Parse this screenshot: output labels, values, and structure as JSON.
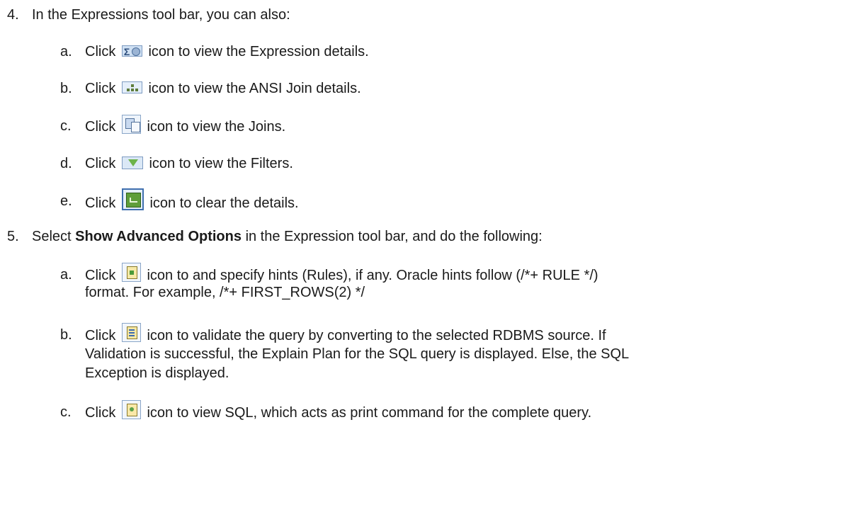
{
  "steps": [
    {
      "number": "4.",
      "text": "In the Expressions tool bar, you can also:",
      "items": [
        {
          "letter": "a.",
          "before": "Click",
          "icon": "expression-details-icon",
          "after": "icon to view the Expression details."
        },
        {
          "letter": "b.",
          "before": "Click",
          "icon": "ansi-join-icon",
          "after": "icon to view the ANSI Join details."
        },
        {
          "letter": "c.",
          "before": "Click",
          "icon": "joins-icon",
          "after": "icon to view the Joins."
        },
        {
          "letter": "d.",
          "before": "Click",
          "icon": "filter-icon",
          "after": "icon to view the Filters."
        },
        {
          "letter": "e.",
          "before": "Click",
          "icon": "clear-details-icon",
          "after": "icon to clear the details."
        }
      ]
    },
    {
      "number": "5.",
      "text_before": "Select",
      "text_bold": "Show Advanced Options",
      "text_after": "in the Expression tool bar, and do the following:",
      "items": [
        {
          "letter": "a.",
          "before": "Click",
          "icon": "hints-icon",
          "after": "icon to and specify hints (Rules), if any. Oracle hints follow (/*+ RULE */)",
          "line2": "format. For example, /*+ FIRST_ROWS(2) */"
        },
        {
          "letter": "b.",
          "before": "Click",
          "icon": "validate-query-icon",
          "after": "icon to validate the query by converting to the selected RDBMS source. If",
          "line2": "Validation is successful, the Explain Plan for the SQL query is displayed. Else, the SQL",
          "line3": "Exception is displayed."
        },
        {
          "letter": "c.",
          "before": "Click",
          "icon": "view-sql-icon",
          "after": "icon to view SQL, which acts as print command for the complete query."
        }
      ]
    }
  ]
}
